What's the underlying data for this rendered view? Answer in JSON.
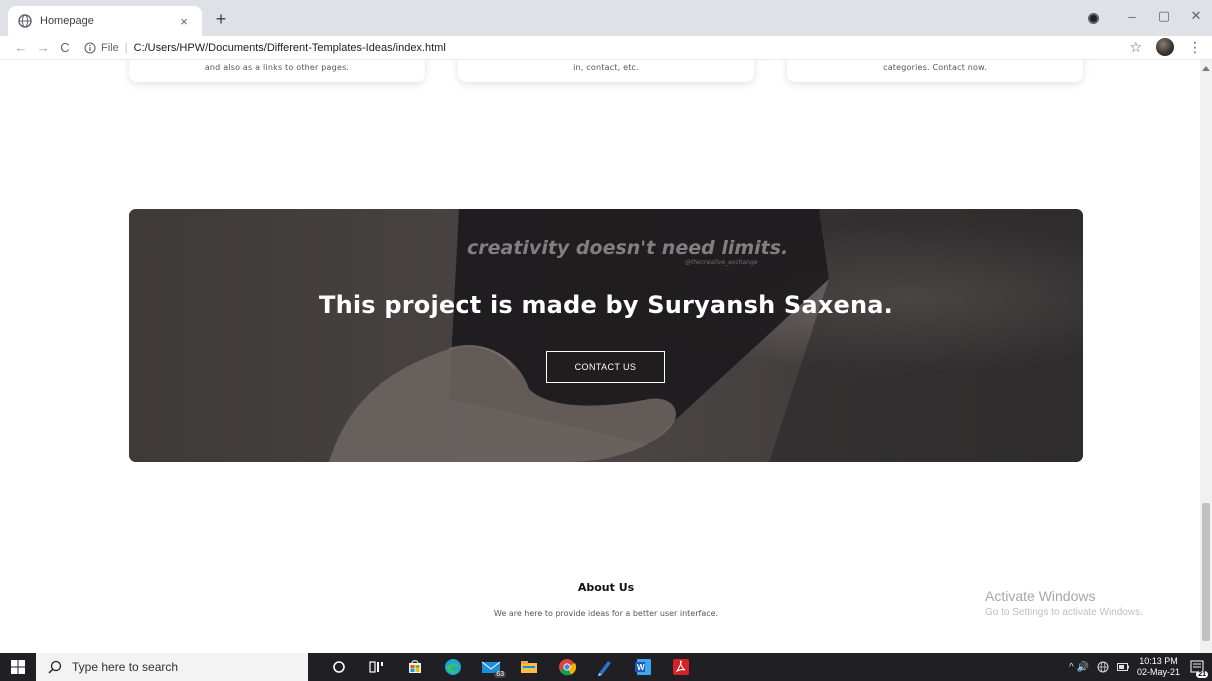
{
  "browser": {
    "tab": {
      "title": "Homepage",
      "close_label": "×"
    },
    "new_tab_label": "+",
    "window_controls": {
      "minimize": "–",
      "restore": "▢",
      "close": "✕"
    },
    "address": {
      "scheme": "File",
      "separator": "|",
      "url": "C:/Users/HPW/Documents/Different-Templates-Ideas/index.html"
    },
    "nav": {
      "back": "←",
      "forward": "→",
      "reload": "C"
    },
    "toolbar_right": {
      "star": "☆",
      "menu": "⋮"
    }
  },
  "page": {
    "cards": [
      {
        "text": "and also as a links to other pages."
      },
      {
        "text": "in, contact, etc."
      },
      {
        "text": "categories. Contact now."
      }
    ],
    "banner": {
      "image_text": "creativity doesn't need limits.",
      "image_subtext": "@thecreative_exchange",
      "heading": "This project is made by Suryansh Saxena.",
      "button_label": "CONTACT US"
    },
    "footer": {
      "title": "About Us",
      "text": "We are here to provide ideas for a better user interface."
    }
  },
  "watermark": {
    "title": "Activate Windows",
    "subtitle": "Go to Settings to activate Windows."
  },
  "taskbar": {
    "search_placeholder": "Type here to search",
    "icons": [
      {
        "name": "cortana-icon",
        "badge": ""
      },
      {
        "name": "task-view-icon",
        "badge": ""
      },
      {
        "name": "store-icon",
        "badge": ""
      },
      {
        "name": "edge-icon",
        "badge": ""
      },
      {
        "name": "mail-icon",
        "badge": "63"
      },
      {
        "name": "file-explorer-icon",
        "badge": ""
      },
      {
        "name": "chrome-icon",
        "badge": ""
      },
      {
        "name": "notes-icon",
        "badge": ""
      },
      {
        "name": "word-icon",
        "badge": ""
      },
      {
        "name": "acrobat-icon",
        "badge": ""
      }
    ],
    "tray_symbols": "^ 🔊",
    "time": "10:13 PM",
    "date": "02-May-21",
    "notification_count": "21"
  },
  "colors": {
    "banner_bg": "#4a4544",
    "taskbar_bg": "#1f1f24",
    "tabstrip_bg": "#dee1e6"
  }
}
